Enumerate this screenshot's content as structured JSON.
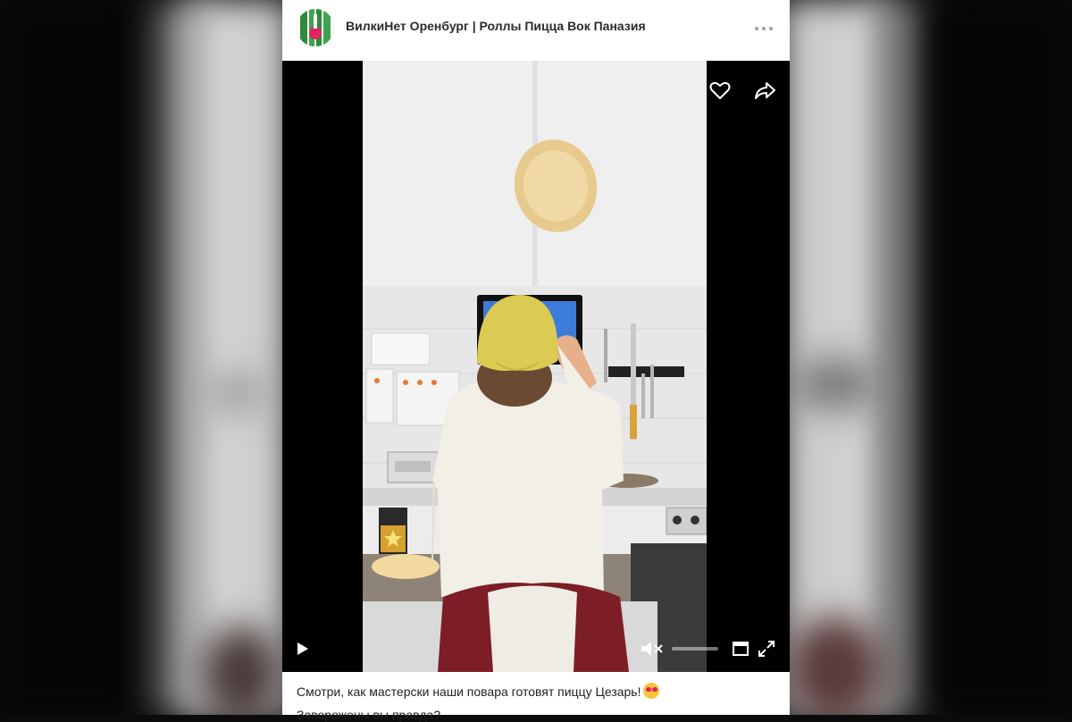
{
  "post": {
    "channel_name": "ВилкиНет Оренбург | Роллы Пицца Вок Паназия",
    "caption": "Смотри, как мастерски наши повара готовят пиццу Цезарь!",
    "caption_emoji": "smiling-face-with-heart-eyes",
    "caption_second_line": "Заворожены вы правда?"
  },
  "video": {
    "playing": false,
    "muted": true,
    "volume_level": 0.0
  },
  "icons": {
    "like": "heart-icon",
    "share": "share-arrow-icon",
    "play": "play-icon",
    "volume": "volume-muted-icon",
    "pip": "picture-in-picture-icon",
    "fullscreen": "fullscreen-icon",
    "more": "more-dots-icon"
  },
  "colors": {
    "card_bg": "#ffffff",
    "text": "#222222",
    "backdrop_dark": "#050505"
  }
}
